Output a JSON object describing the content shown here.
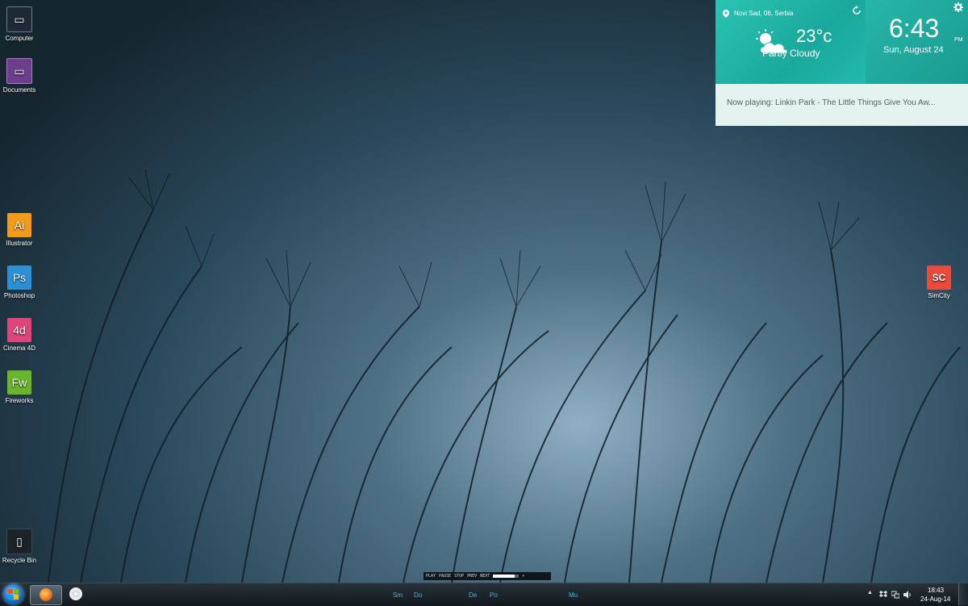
{
  "desktop": {
    "icons": [
      {
        "label": "Computer",
        "glyph": "▭",
        "color": "#1d2a36"
      },
      {
        "label": "Documents",
        "glyph": "▭",
        "color": "#6b3d8a"
      },
      {
        "label": "Illustrator",
        "glyph": "Ai",
        "color": "#f29a1b"
      },
      {
        "label": "Photoshop",
        "glyph": "Ps",
        "color": "#2d8fd6"
      },
      {
        "label": "Cinema 4D",
        "glyph": "4d",
        "color": "#e0457a"
      },
      {
        "label": "Fireworks",
        "glyph": "Fw",
        "color": "#69b52b"
      },
      {
        "label": "Recycle Bin",
        "glyph": "▯",
        "color": "#1b2228"
      },
      {
        "label": "SimCity",
        "glyph": "SC",
        "color": "#e94a3a"
      }
    ]
  },
  "widget": {
    "location": "Novi Sad, 06, Serbia",
    "temperature": "23°c",
    "condition": "Partly Cloudy",
    "time": "6:43",
    "ampm": "PM",
    "date": "Sun, August 24",
    "now_playing": "Now playing: Linkin Park - The Little Things Give You Aw..."
  },
  "media_bar": {
    "play": "PLAY",
    "pause": "PAUSE",
    "stop": "STOP",
    "prev": "PREV",
    "next": "NEXT",
    "progress": 0.85
  },
  "dock": {
    "items": [
      "Sm",
      "Do",
      "De",
      "Po",
      "Mu"
    ]
  },
  "tray": {
    "time": "18:43",
    "date": "24-Aug-14"
  },
  "colors": {
    "accent": "#1fb3a5",
    "dock_text": "#3fb8e0"
  }
}
